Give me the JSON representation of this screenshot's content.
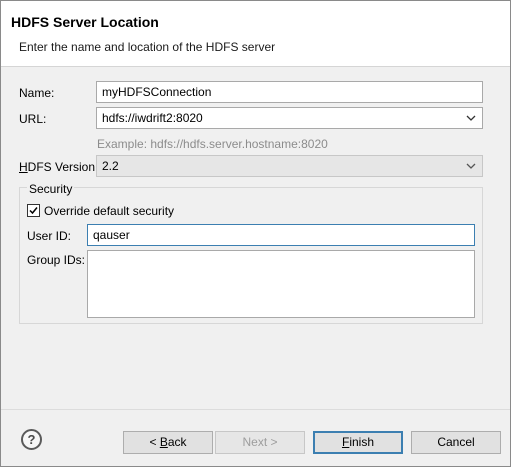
{
  "header": {
    "title": "HDFS Server Location",
    "description": "Enter the name and location of the HDFS server"
  },
  "form": {
    "name_label": "Name:",
    "name_value": "myHDFSConnection",
    "url_label": "URL:",
    "url_value": "hdfs://iwdrift2:8020",
    "url_example": "Example: hdfs://hdfs.server.hostname:8020",
    "version_label_mnemonic": "H",
    "version_label_rest": "DFS Version:",
    "version_value": "2.2"
  },
  "security": {
    "legend": "Security",
    "override_label": "Override default security",
    "override_checked": true,
    "user_id_label": "User ID:",
    "user_id_value": "qauser",
    "group_ids_label": "Group IDs:",
    "group_ids_value": ""
  },
  "footer": {
    "help_glyph": "?",
    "back_prefix": "< ",
    "back_mnemonic": "B",
    "back_rest": "ack",
    "next_label": "Next >",
    "finish_mnemonic": "F",
    "finish_rest": "inish",
    "cancel_label": "Cancel"
  },
  "colors": {
    "focus_border": "#3c7fb1",
    "hint_text": "#8c8c8c"
  }
}
